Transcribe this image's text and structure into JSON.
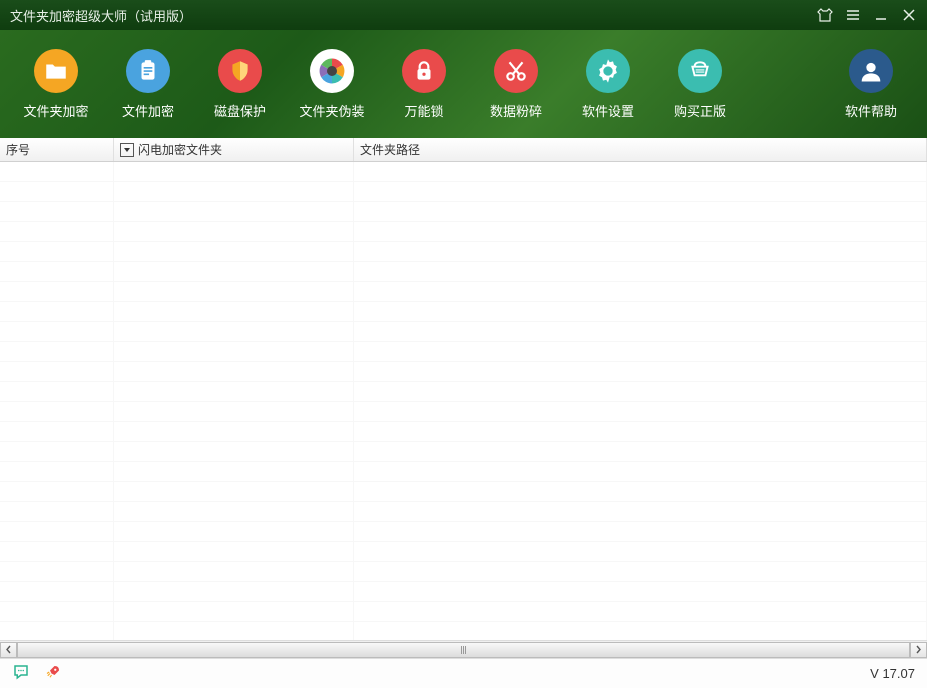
{
  "titlebar": {
    "title": "文件夹加密超级大师（试用版）"
  },
  "toolbar": {
    "items": [
      {
        "label": "文件夹加密"
      },
      {
        "label": "文件加密"
      },
      {
        "label": "磁盘保护"
      },
      {
        "label": "文件夹伪装"
      },
      {
        "label": "万能锁"
      },
      {
        "label": "数据粉碎"
      },
      {
        "label": "软件设置"
      },
      {
        "label": "购买正版"
      }
    ],
    "help_label": "软件帮助"
  },
  "table": {
    "columns": {
      "index": "序号",
      "folder": "闪电加密文件夹",
      "path": "文件夹路径"
    },
    "rows": []
  },
  "statusbar": {
    "version": "V 17.07"
  },
  "colors": {
    "icon_orange": "#f5a623",
    "icon_blue": "#4aa3df",
    "icon_red": "#e94b4b",
    "icon_teal": "#3bbdb0",
    "icon_navy": "#2b5a8c"
  }
}
